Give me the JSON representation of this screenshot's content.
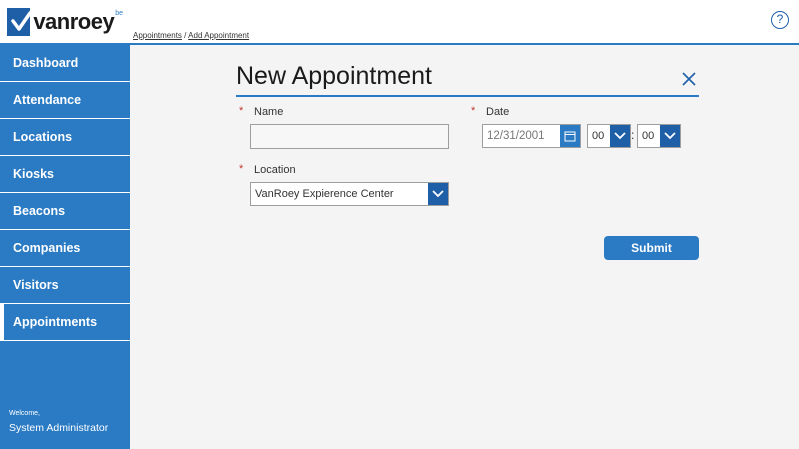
{
  "header": {
    "logo_text": "vanroey",
    "logo_sup": "be",
    "breadcrumb": [
      {
        "label": "Appointments"
      },
      {
        "label": "Add Appointment"
      }
    ],
    "breadcrumb_separator": "/",
    "help_label": "?"
  },
  "sidebar": {
    "items": [
      {
        "label": "Dashboard"
      },
      {
        "label": "Attendance"
      },
      {
        "label": "Locations"
      },
      {
        "label": "Kiosks"
      },
      {
        "label": "Beacons"
      },
      {
        "label": "Companies"
      },
      {
        "label": "Visitors"
      },
      {
        "label": "Appointments",
        "active": true
      }
    ],
    "welcome_label": "Welcome,",
    "user_name": "System Administrator"
  },
  "form": {
    "title": "New Appointment",
    "required_marker": "*",
    "name_label": "Name",
    "name_value": "",
    "date_label": "Date",
    "date_value": "12/31/2001",
    "hour_value": "00",
    "minute_value": "00",
    "time_separator": ":",
    "location_label": "Location",
    "location_value": "VanRoey Expierence Center",
    "submit_label": "Submit"
  },
  "colors": {
    "accent": "#2b7bc4",
    "accent_dark": "#1f5fa8",
    "required": "#c0392b"
  }
}
